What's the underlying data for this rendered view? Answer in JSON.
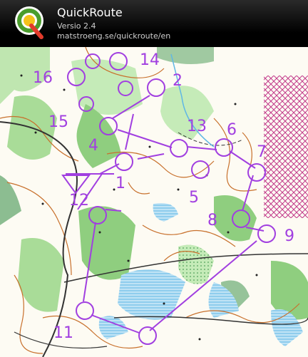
{
  "header": {
    "app_title": "QuickRoute",
    "version": "Versio 2.4",
    "url": "matstroeng.se/quickroute/en",
    "logo_letter": "Q"
  },
  "map": {
    "course_color": "#a13fe0",
    "control_numbers": [
      "1",
      "2",
      "4",
      "5",
      "6",
      "7",
      "8",
      "9",
      "11",
      "12",
      "13",
      "14",
      "15",
      "16"
    ]
  },
  "colors": {
    "map_background": "#fdfbf3",
    "forest_green": "#8fce7f",
    "dark_green": "#2f8b3f",
    "contour_brown": "#c8702c",
    "water_blue": "#5fb7e5",
    "forbidden_area": "#c23a8a"
  }
}
